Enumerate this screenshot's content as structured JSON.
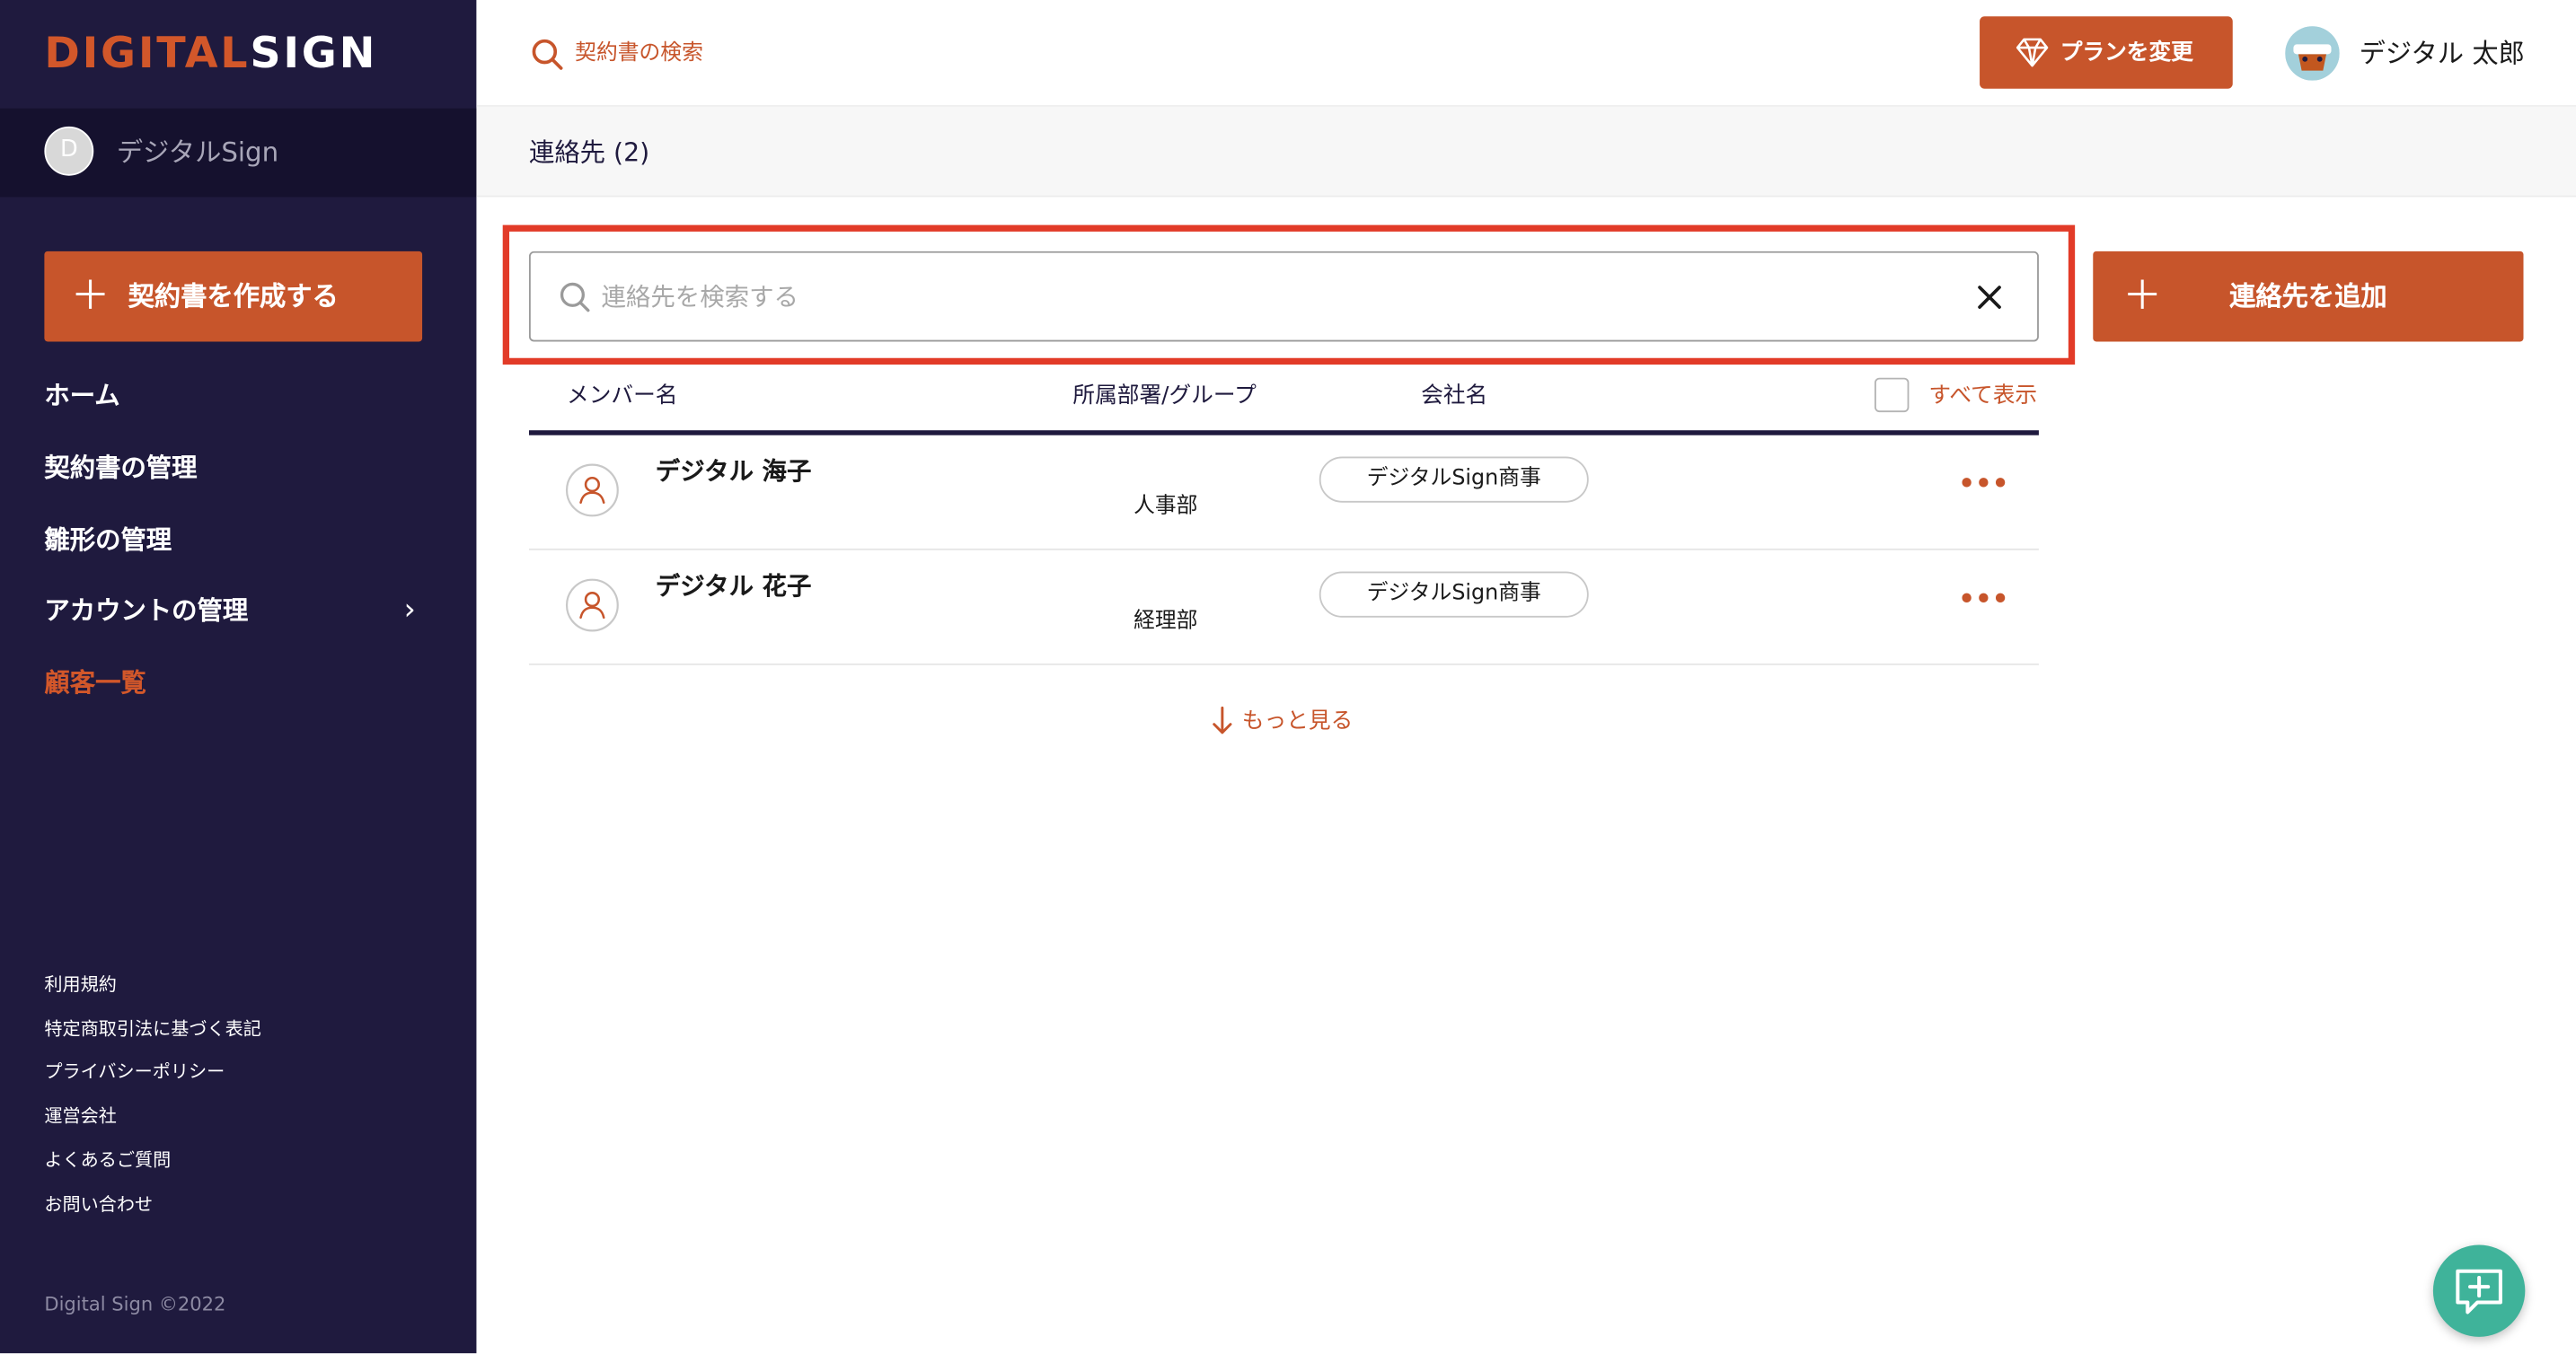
{
  "brand": {
    "logo_part1": "DIGITAL",
    "logo_part2": "SIGN",
    "accent": "#c7552b",
    "sidebar_bg": "#1f1a3e"
  },
  "org": {
    "initial": "D",
    "name": "デジタルSign"
  },
  "sidebar": {
    "create_label": "契約書を作成する",
    "items": [
      {
        "label": "ホーム"
      },
      {
        "label": "契約書の管理"
      },
      {
        "label": "雛形の管理"
      },
      {
        "label": "アカウントの管理"
      },
      {
        "label": "顧客一覧",
        "active": true
      }
    ],
    "footer_links": [
      "利用規約",
      "特定商取引法に基づく表記",
      "プライバシーポリシー",
      "運営会社",
      "よくあるご質問",
      "お問い合わせ"
    ],
    "copyright": "Digital Sign ©2022"
  },
  "header": {
    "search_label": "契約書の検索",
    "plan_label": "プランを変更",
    "user_name": "デジタル 太郎"
  },
  "page": {
    "title": "連絡先 (2)"
  },
  "contacts": {
    "search_placeholder": "連絡先を検索する",
    "add_label": "連絡先を追加",
    "columns": {
      "member": "メンバー名",
      "dept": "所属部署/グループ",
      "company": "会社名"
    },
    "show_all": "すべて表示",
    "rows": [
      {
        "name": "デジタル 海子",
        "dept": "人事部",
        "company": "デジタルSign商事"
      },
      {
        "name": "デジタル 花子",
        "dept": "経理部",
        "company": "デジタルSign商事"
      }
    ],
    "more_label": "もっと見る",
    "more_icon": "ellipsis-icon"
  }
}
